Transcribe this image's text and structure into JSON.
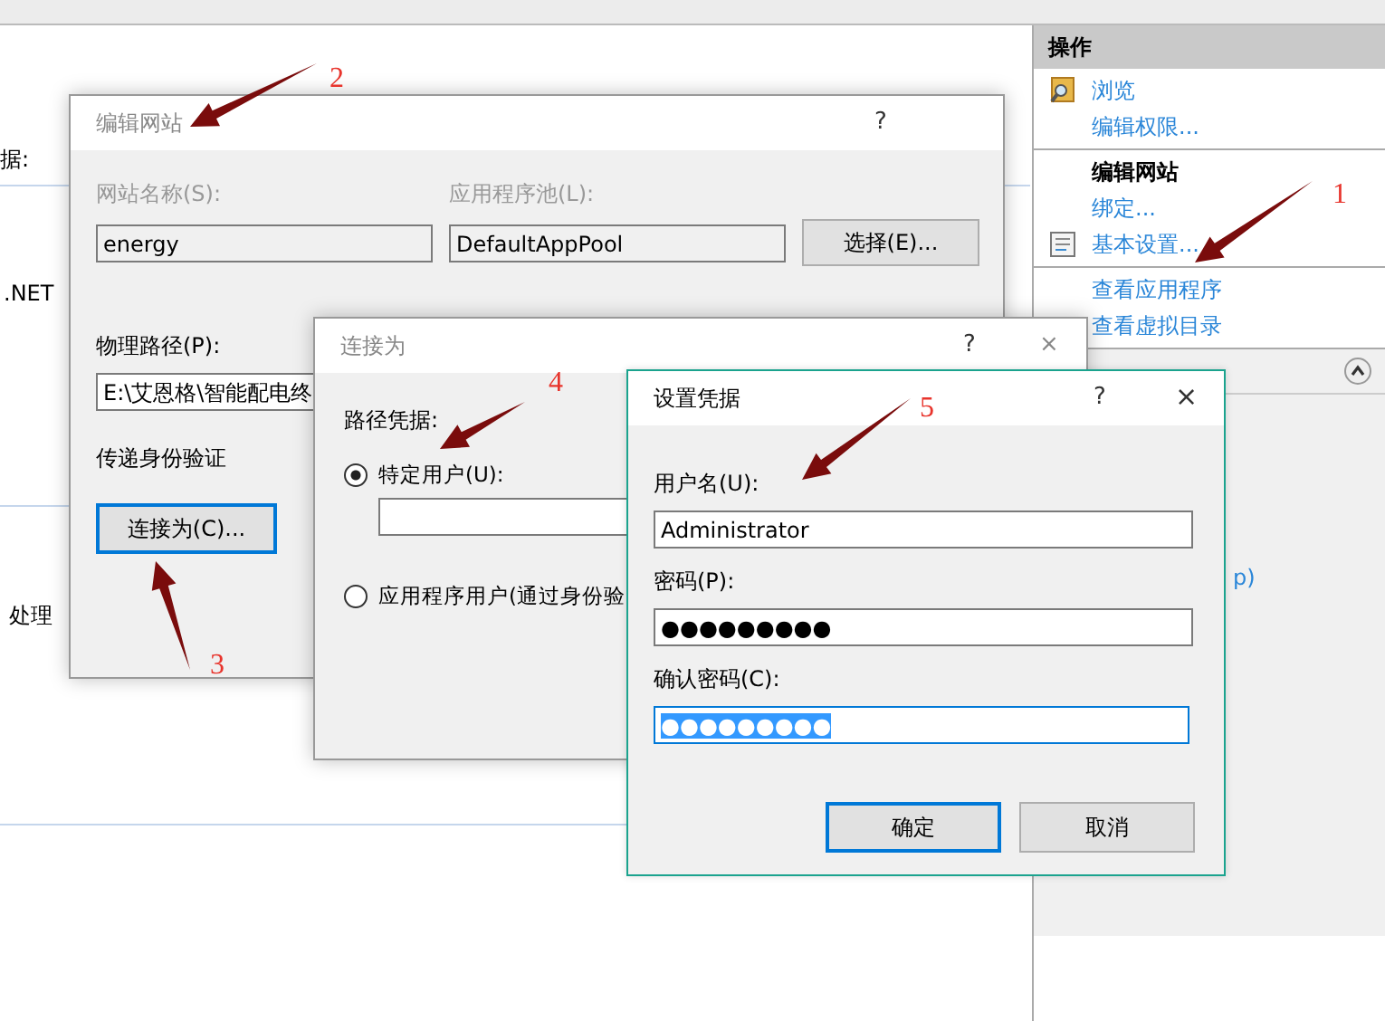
{
  "main_window": {
    "left_fragments": [
      {
        "text": "据:"
      },
      {
        "text": ".NET"
      },
      {
        "text": "处理"
      }
    ],
    "actions_pane": {
      "title": "操作",
      "sections": [
        {
          "items": [
            {
              "label": "浏览",
              "kind": "link"
            },
            {
              "label": "编辑权限...",
              "kind": "link"
            }
          ]
        },
        {
          "items": [
            {
              "label": "编辑网站",
              "kind": "heading"
            },
            {
              "label": "绑定...",
              "kind": "link"
            },
            {
              "label": "基本设置...",
              "kind": "link"
            }
          ]
        },
        {
          "items": [
            {
              "label": "查看应用程序",
              "kind": "link"
            },
            {
              "label": "查看虚拟目录",
              "kind": "link"
            }
          ]
        }
      ],
      "lower_fragment": "p)"
    }
  },
  "edit_site_dialog": {
    "title": "编辑网站",
    "active": false,
    "help": "?",
    "site_name": {
      "label": "网站名称(S):",
      "value": "energy",
      "disabled": true
    },
    "app_pool": {
      "label": "应用程序池(L):",
      "value": "DefaultAppPool",
      "disabled": true
    },
    "select_button": "选择(E)...",
    "physical_path": {
      "label": "物理路径(P):",
      "value": "E:\\艾恩格\\智能配电终"
    },
    "pass_through_label": "传递身份验证",
    "connect_as_button": {
      "label": "连接为(C)...",
      "focused": true
    }
  },
  "connect_as_dialog": {
    "title": "连接为",
    "active": false,
    "help": "?",
    "close": "×",
    "group_label": "路径凭据:",
    "options": [
      {
        "label": "特定用户(U):",
        "selected": true
      },
      {
        "label": "应用程序用户(通过身份验",
        "selected": false
      }
    ]
  },
  "credentials_dialog": {
    "title": "设置凭据",
    "active": true,
    "help": "?",
    "close": "×",
    "fields": [
      {
        "label": "用户名(U):",
        "value": "Administrator",
        "focused": false,
        "text_selected": false
      },
      {
        "label": "密码(P):",
        "value": "●●●●●●●●●",
        "focused": false,
        "text_selected": false
      },
      {
        "label": "确认密码(C):",
        "value": "●●●●●●●●●",
        "focused": true,
        "text_selected": true
      }
    ],
    "buttons": [
      {
        "label": "确定",
        "focused": true
      },
      {
        "label": "取消",
        "focused": false
      }
    ]
  },
  "annotations": [
    {
      "label": "1"
    },
    {
      "label": "2"
    },
    {
      "label": "3"
    },
    {
      "label": "4"
    },
    {
      "label": "5"
    }
  ]
}
